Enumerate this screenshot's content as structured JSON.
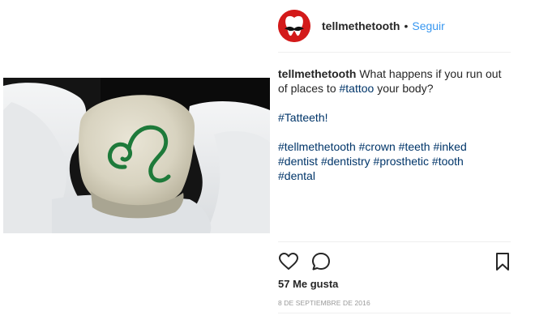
{
  "post": {
    "username": "tellmethetooth",
    "separator": "•",
    "follow_label": "Seguir",
    "caption": {
      "username": "tellmethetooth",
      "text_1": " What happens if you run out of places to ",
      "text_1_tag": "#tattoo",
      "text_1_end": " your body?",
      "line_2_tag": "#Tatteeth!",
      "hashtags_line_a": [
        "#tellmethetooth",
        "#crown",
        "#teeth",
        "#inked"
      ],
      "hashtags_line_b": [
        "#dentist",
        "#dentistry",
        "#prosthetic",
        "#tooth"
      ],
      "hashtags_line_c": [
        "#dental"
      ]
    },
    "likes_text": "57 Me gusta",
    "date_text": "8 DE SEPTIEMBRE DE 2016"
  },
  "icons": {
    "like": "heart-icon",
    "comment": "comment-icon",
    "save": "bookmark-icon"
  },
  "colors": {
    "link_blue": "#3897f0",
    "hashtag_navy": "#003569",
    "avatar_red": "#d31a1a",
    "tattoo_green": "#1e7a3a"
  }
}
